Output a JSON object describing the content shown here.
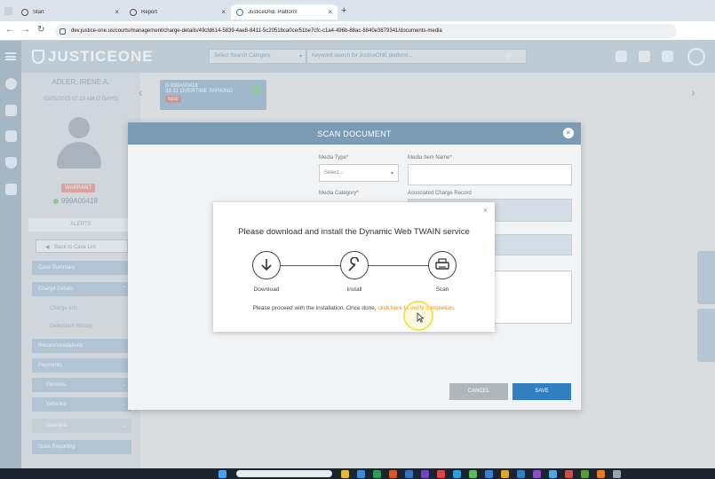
{
  "browser": {
    "tabs": [
      {
        "title": "Start",
        "active": false
      },
      {
        "title": "Report",
        "active": false
      },
      {
        "title": "JusticeONE Platform",
        "active": true
      }
    ],
    "url": "dev.justice-one.us/courts/management/charge-details/49cfd614-5839-4ae8-8411-5c2051bca0ce/51be7cfc-c1a4-496b-88ac-8840e3879341/documents-media"
  },
  "header": {
    "logo": "JUSTICEONE",
    "search_category_placeholder": "Select Search Category",
    "search_keyword_placeholder": "Keyword search for JusticeONE platform..."
  },
  "person": {
    "name": "ADLER, IRENE A.",
    "date": "03/05/2023 07:13 AM (2 DAYS)",
    "warrant_badge": "WARRANT",
    "case_number": "999A00418"
  },
  "sidebar": {
    "alerts": "ALERTS",
    "back_label": "Back to Case List",
    "items": [
      {
        "label": "Case Summary"
      },
      {
        "label": "Charge Details"
      },
      {
        "label": "Charge Info"
      },
      {
        "label": "Defendant History"
      },
      {
        "label": "Recommendations"
      },
      {
        "label": "Payments"
      },
      {
        "label": "Persons"
      },
      {
        "label": "Vehicles"
      },
      {
        "label": "Warrants"
      },
      {
        "label": "State Reporting"
      }
    ]
  },
  "charge_card": {
    "code": "B-999A00418",
    "title": "32-11 OVERTIME PARKING",
    "badge": "NEW"
  },
  "scan_modal": {
    "title": "SCAN DOCUMENT",
    "media_type_label": "Media Type",
    "media_type_value": "Select...",
    "media_item_name_label": "Media Item Name",
    "media_category_label": "Media Category",
    "associated_charge_label": "Associated Charge Record",
    "cancel_label": "CANCEL",
    "save_label": "SAVE"
  },
  "twain_dialog": {
    "title": "Please download and install the Dynamic Web TWAIN service",
    "steps": [
      {
        "label": "Download",
        "icon": "download-icon"
      },
      {
        "label": "Install",
        "icon": "wrench-icon"
      },
      {
        "label": "Scan",
        "icon": "scanner-icon"
      }
    ],
    "message": "Please proceed with the installation. Once done,",
    "link_text": "click here to verify completion."
  },
  "colors": {
    "modal_header": "#7b9cb4",
    "save_button": "#2f7fc1",
    "link": "#e08a1e"
  }
}
